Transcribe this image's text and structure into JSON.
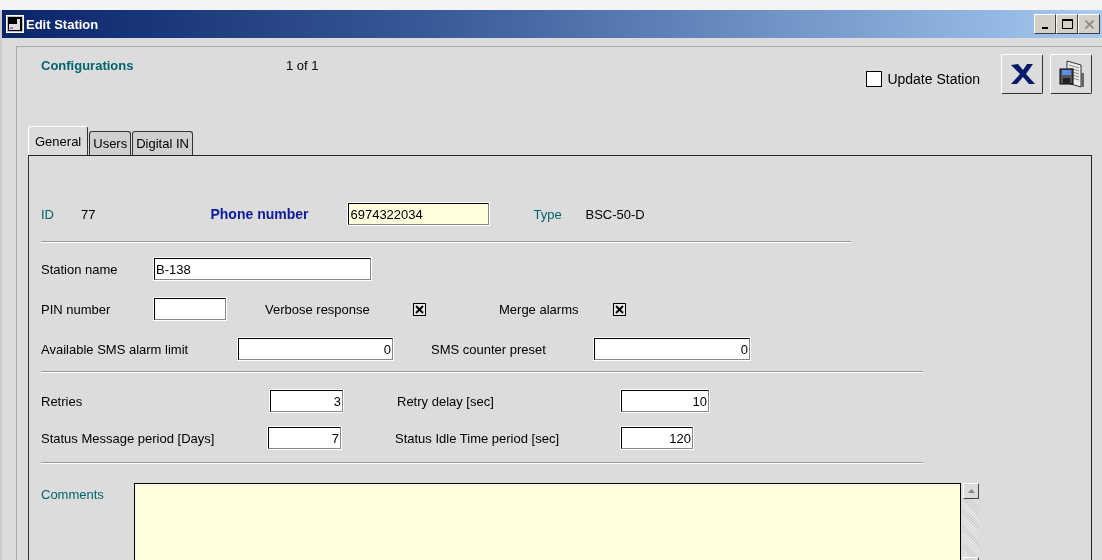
{
  "window": {
    "title": "Edit Station"
  },
  "header": {
    "title": "Configurations",
    "record": "1 of 1",
    "update_station": {
      "label": "Update Station",
      "checked": false
    }
  },
  "tabs": [
    {
      "label": "General",
      "selected": true
    },
    {
      "label": "Users",
      "selected": false
    },
    {
      "label": "Digital IN",
      "selected": false
    }
  ],
  "sections": [
    {
      "rows": [
        {
          "fields": [
            {
              "kind": "readout",
              "label": "ID",
              "value": "77"
            },
            {
              "kind": "key-field",
              "label": "Phone number",
              "value": "6974322034"
            },
            {
              "kind": "readout",
              "label": "Type",
              "value": "BSC-50-D"
            }
          ]
        }
      ]
    },
    {
      "rows": [
        {
          "fields": [
            {
              "kind": "field",
              "label": "Station name",
              "value": "B-138"
            }
          ]
        },
        {
          "fields": [
            {
              "kind": "field",
              "label": "PIN number"
            },
            {
              "kind": "checkbox",
              "label": "Verbose response",
              "checked": true
            },
            {
              "kind": "checkbox",
              "label": "Merge alarms",
              "checked": true
            }
          ]
        },
        {
          "fields": [
            {
              "kind": "number",
              "label": "Available SMS alarm limit",
              "value": "0"
            },
            {
              "kind": "number",
              "label": "SMS counter preset",
              "value": "0"
            }
          ]
        }
      ]
    },
    {
      "rows": [
        {
          "fields": [
            {
              "kind": "number",
              "label": "Retries",
              "value": "3"
            },
            {
              "kind": "number",
              "label": "Retry delay [sec]",
              "value": "10"
            }
          ]
        },
        {
          "fields": [
            {
              "kind": "number",
              "label": "Status Message period [Days]",
              "value": "7"
            },
            {
              "kind": "number",
              "label": "Status Idle Time period [sec]",
              "value": "120"
            }
          ]
        }
      ]
    },
    {
      "rows": [
        {
          "fields": [
            {
              "kind": "memo",
              "label": "Comments"
            }
          ]
        }
      ]
    }
  ]
}
